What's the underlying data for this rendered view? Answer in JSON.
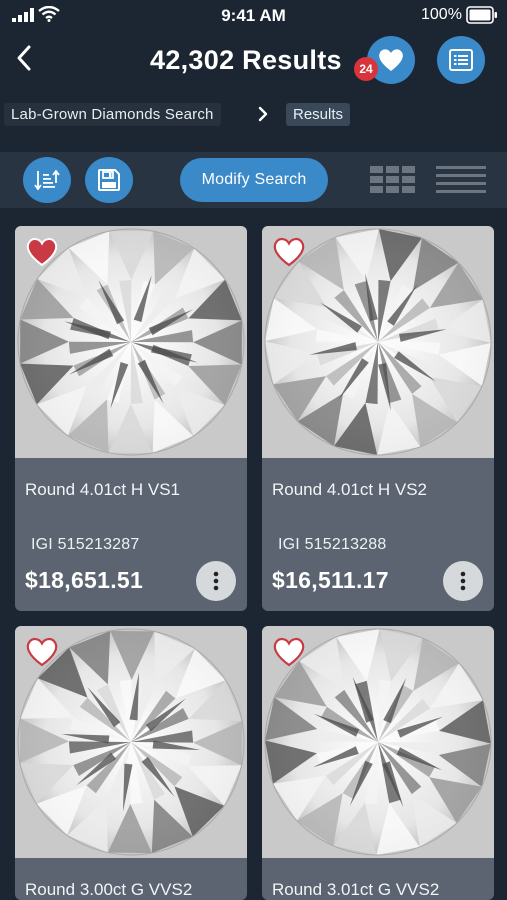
{
  "status_bar": {
    "time": "9:41 AM",
    "battery": "100%"
  },
  "header": {
    "title": "42,302 Results",
    "favorites_count": "24"
  },
  "breadcrumb": {
    "items": [
      "Lab-Grown Diamonds Search",
      "Results"
    ]
  },
  "toolbar": {
    "modify_label": "Modify Search"
  },
  "cards": [
    {
      "title": "Round 4.01ct H VS1",
      "cert": "IGI 515213287",
      "price": "$18,651.51",
      "favorited": true
    },
    {
      "title": "Round 4.01ct H VS2",
      "cert": "IGI 515213288",
      "price": "$16,511.17",
      "favorited": false
    },
    {
      "title": "Round 3.00ct G VVS2",
      "cert": "",
      "price": "",
      "favorited": false
    },
    {
      "title": "Round 3.01ct G VVS2",
      "cert": "",
      "price": "",
      "favorited": false
    }
  ],
  "colors": {
    "accent": "#3a89c9",
    "badge": "#d8343c",
    "background": "#1c2632",
    "card": "#5b6470"
  }
}
